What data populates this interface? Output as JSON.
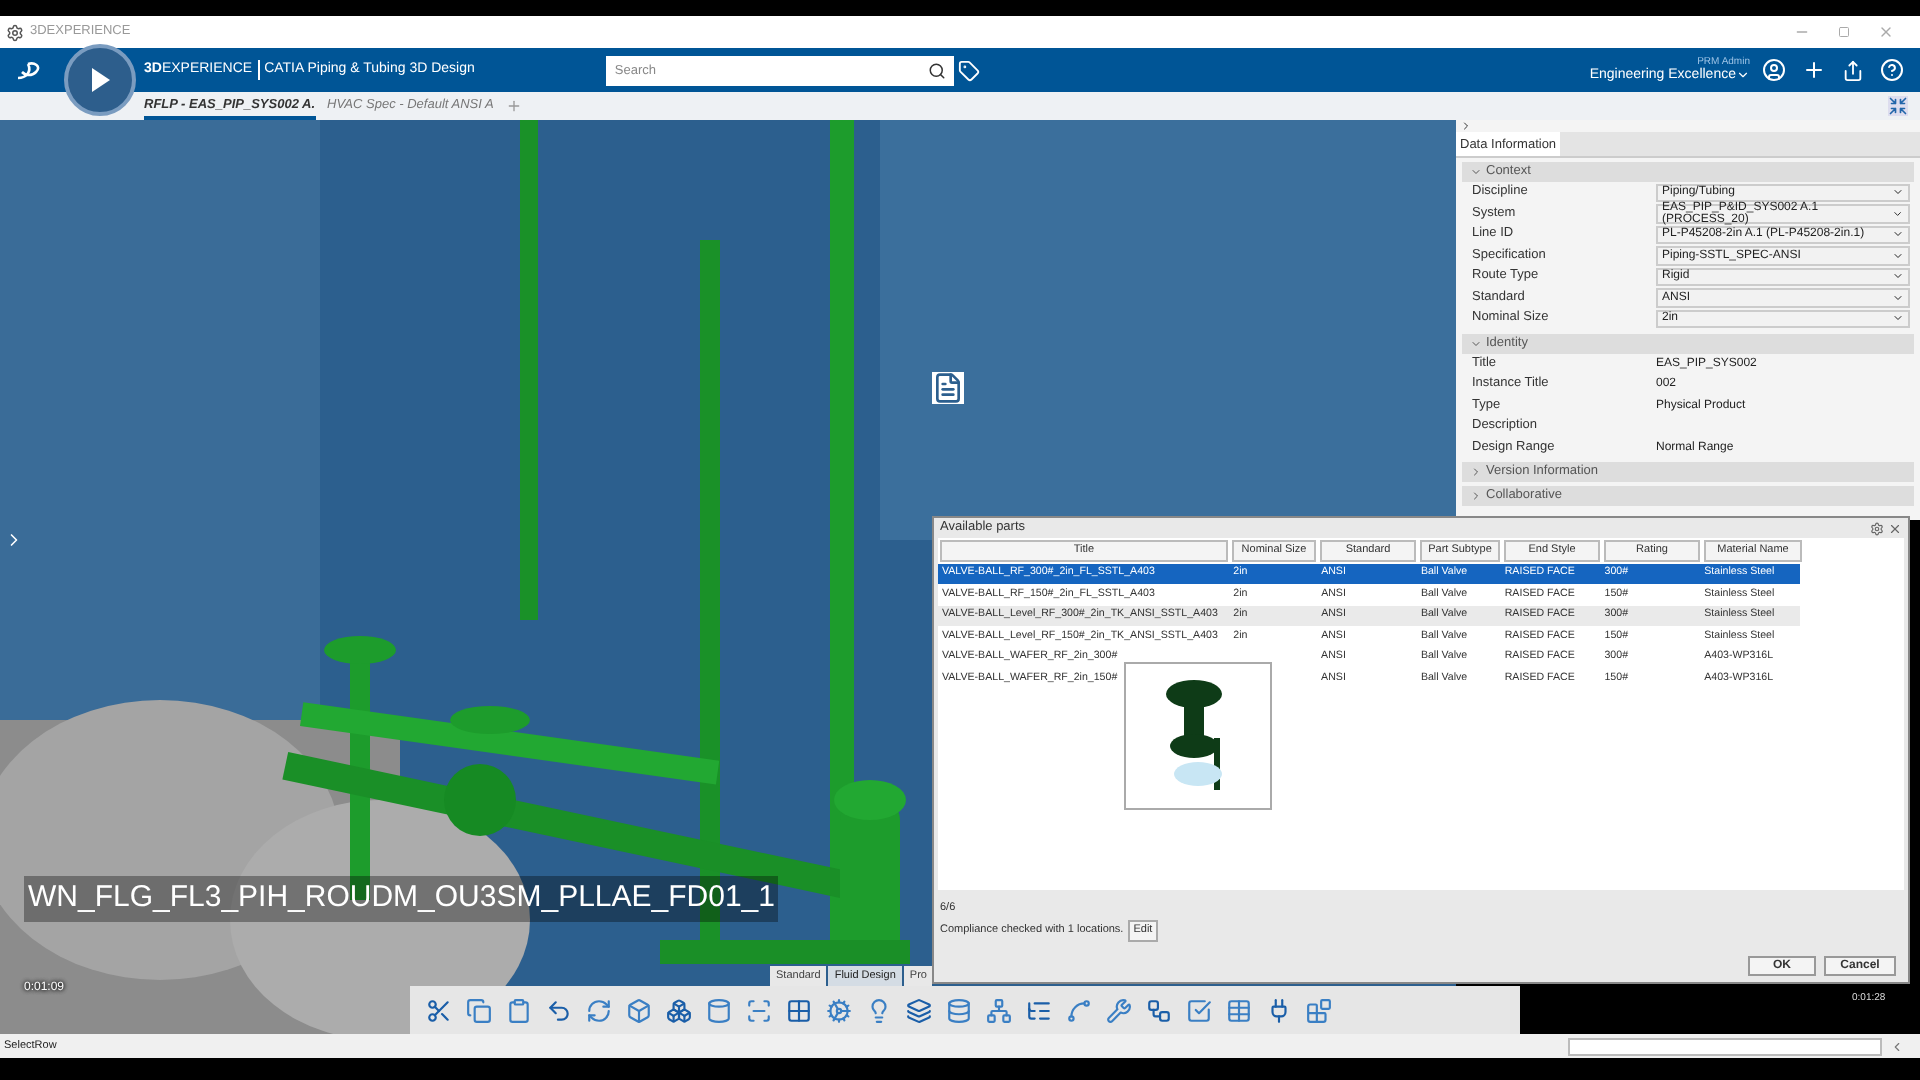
{
  "window": {
    "title": "3DEXPERIENCE"
  },
  "header": {
    "brand_bold": "3D",
    "brand": "EXPERIENCE",
    "app": "CATIA Piping & Tubing 3D Design",
    "search_placeholder": "Search",
    "user": "PRM Admin",
    "space": "Engineering Excellence"
  },
  "tabs": [
    {
      "label": "RFLP - EAS_PIP_SYS002 A.",
      "selected": true
    },
    {
      "label": "HVAC Spec - Default ANSI A",
      "selected": false
    }
  ],
  "viewport": {
    "object_label": "WN_FLG_FL3_PIH_ROUDM_OU3SM_PLLAE_FD01_1",
    "time_left": "0:01:09",
    "time_right": "0:01:28"
  },
  "panel": {
    "tab": "Data Information",
    "sections": [
      {
        "title": "Context",
        "expanded": true,
        "fields": [
          {
            "label": "Discipline",
            "value": "Piping/Tubing",
            "kind": "dropdown"
          },
          {
            "label": "System",
            "value": "EAS_PIP_P&ID_SYS002 A.1 (PROCESS_20)",
            "kind": "dropdown"
          },
          {
            "label": "Line ID",
            "value": "PL-P45208-2in A.1 (PL-P45208-2in.1)",
            "kind": "dropdown"
          },
          {
            "label": "Specification",
            "value": "Piping-SSTL_SPEC-ANSI",
            "kind": "dropdown"
          },
          {
            "label": "Route Type",
            "value": "Rigid",
            "kind": "dropdown"
          },
          {
            "label": "Standard",
            "value": "ANSI",
            "kind": "dropdown"
          },
          {
            "label": "Nominal Size",
            "value": "2in",
            "kind": "dropdown"
          }
        ]
      },
      {
        "title": "Identity",
        "expanded": true,
        "fields": [
          {
            "label": "Title",
            "value": "EAS_PIP_SYS002",
            "kind": "text"
          },
          {
            "label": "Instance Title",
            "value": "002",
            "kind": "text"
          },
          {
            "label": "Type",
            "value": "Physical Product",
            "kind": "text"
          },
          {
            "label": "Description",
            "kind": "text"
          },
          {
            "label": "Design Range",
            "value": "Normal Range",
            "kind": "text"
          }
        ]
      },
      {
        "title": "Version Information",
        "expanded": false
      },
      {
        "title": "Collaborative",
        "expanded": false
      }
    ]
  },
  "dialog": {
    "title": "Available parts",
    "columns": [
      "Title",
      "Nominal Size",
      "Standard",
      "Part Subtype",
      "End Style",
      "Rating",
      "Material Name"
    ],
    "rows": [
      {
        "cells": [
          "VALVE-BALL_RF_300#_2in_FL_SSTL_A403",
          "2in",
          "ANSI",
          "Ball Valve",
          "RAISED FACE",
          "300#",
          "Stainless Steel"
        ],
        "selected": true,
        "hovered": false
      },
      {
        "cells": [
          "VALVE-BALL_RF_150#_2in_FL_SSTL_A403",
          "2in",
          "ANSI",
          "Ball Valve",
          "RAISED FACE",
          "150#",
          "Stainless Steel"
        ],
        "selected": false,
        "hovered": false
      },
      {
        "cells": [
          "VALVE-BALL_Level_RF_300#_2in_TK_ANSI_SSTL_A403",
          "2in",
          "ANSI",
          "Ball Valve",
          "RAISED FACE",
          "300#",
          "Stainless Steel"
        ],
        "selected": false,
        "hovered": true
      },
      {
        "cells": [
          "VALVE-BALL_Level_RF_150#_2in_TK_ANSI_SSTL_A403",
          "2in",
          "ANSI",
          "Ball Valve",
          "RAISED FACE",
          "150#",
          "Stainless Steel"
        ],
        "selected": false,
        "hovered": false
      },
      {
        "cells": [
          "VALVE-BALL_WAFER_RF_2in_300#",
          null,
          "ANSI",
          "Ball Valve",
          "RAISED FACE",
          "300#",
          "A403-WP316L"
        ],
        "selected": false,
        "hovered": false
      },
      {
        "cells": [
          "VALVE-BALL_WAFER_RF_2in_150#",
          null,
          "ANSI",
          "Ball Valve",
          "RAISED FACE",
          "150#",
          "A403-WP316L"
        ],
        "selected": false,
        "hovered": false
      }
    ],
    "count": "6/6",
    "compliance": "Compliance checked with 1 locations.",
    "edit": "Edit",
    "ok": "OK",
    "cancel": "Cancel"
  },
  "workbench_tabs": [
    {
      "label": "Standard",
      "selected": false
    },
    {
      "label": "Fluid Design",
      "selected": true
    },
    {
      "label": "Pro",
      "selected": false
    }
  ],
  "status_bar": {
    "command": "SelectRow"
  }
}
